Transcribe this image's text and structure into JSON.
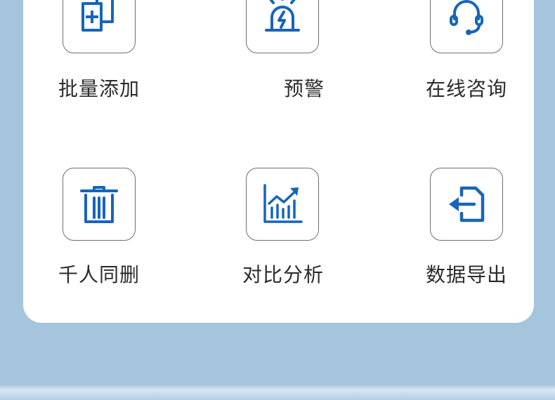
{
  "actions": {
    "batch_add": {
      "label": "批量添加",
      "icon": "batch-add-icon"
    },
    "alert": {
      "label": "预警",
      "icon": "siren-icon"
    },
    "consult": {
      "label": "在线咨询",
      "icon": "headset-icon"
    },
    "delete": {
      "label": "千人同删",
      "icon": "trash-icon"
    },
    "compare": {
      "label": "对比分析",
      "icon": "chart-icon"
    },
    "export": {
      "label": "数据导出",
      "icon": "export-icon"
    }
  },
  "colors": {
    "accent": "#1665b9",
    "background": "#a5c5dc",
    "card": "#ffffff",
    "text": "#2b2b2b"
  }
}
